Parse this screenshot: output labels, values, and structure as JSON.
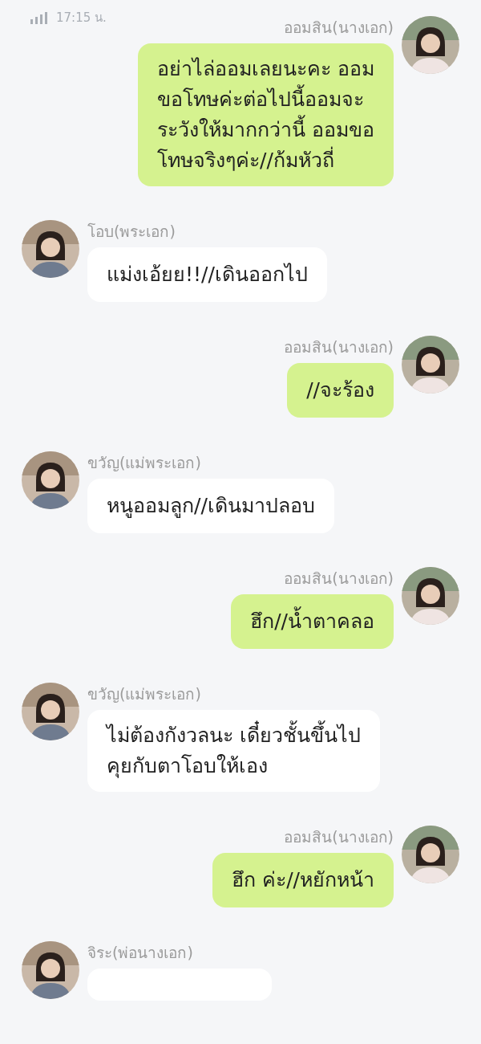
{
  "status_bar": {
    "time": "17:15 น."
  },
  "messages": [
    {
      "kind": "sent",
      "sender": "ออมสิน(นางเอก)",
      "text": "อย่าไล่ออมเลยนะคะ ออม\nขอโทษค่ะต่อไปนี้ออมจะ\nระวังให้มากกว่านี้ ออมขอ\nโทษจริงๆค่ะ//ก้มหัวถี่"
    },
    {
      "kind": "received",
      "sender": "โอบ(พระเอก)",
      "text": "แม่งเอ้ยย!!//เดินออกไป"
    },
    {
      "kind": "sent",
      "sender": "ออมสิน(นางเอก)",
      "text": "//จะร้อง"
    },
    {
      "kind": "received",
      "sender": "ขวัญ(แม่พระเอก)",
      "text": "หนูออมลูก//เดินมาปลอบ"
    },
    {
      "kind": "sent",
      "sender": "ออมสิน(นางเอก)",
      "text": "ฮึก//น้ำตาคลอ"
    },
    {
      "kind": "received",
      "sender": "ขวัญ(แม่พระเอก)",
      "text": "ไม่ต้องกังวลนะ เดี๋ยวชั้นขึ้นไป\nคุยกับตาโอบให้เอง"
    },
    {
      "kind": "sent",
      "sender": "ออมสิน(นางเอก)",
      "text": "ฮึก ค่ะ//หยักหน้า"
    },
    {
      "kind": "received",
      "sender": "จิระ(พ่อนางเอก)"
    }
  ]
}
